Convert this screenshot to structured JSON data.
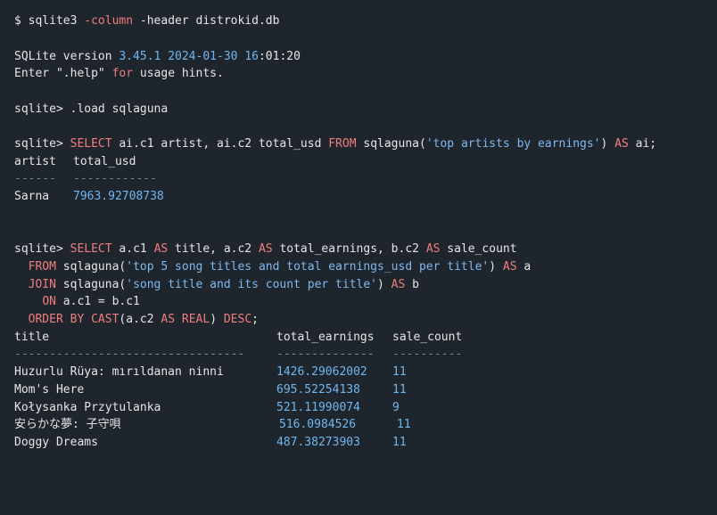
{
  "command": {
    "prompt": "$ ",
    "program": "sqlite3 ",
    "flag": "-column",
    "rest": " -header distrokid.db"
  },
  "banner": {
    "v_prefix": "SQLite version ",
    "version": "3.45.1",
    "sp": " ",
    "date": "2024-01-30",
    "sp2": " ",
    "hour": "16",
    "colon": ":01:20",
    "help_a": "Enter \".help\" ",
    "help_for": "for",
    "help_b": " usage hints."
  },
  "load": {
    "prompt": "sqlite> ",
    "text": ".load sqlaguna"
  },
  "query1": {
    "prompt": "sqlite> ",
    "select": "SELECT",
    "p1": " ai.c1 artist, ai.c2 total_usd ",
    "from": "FROM",
    "p2": " sqlaguna(",
    "str": "'top artists by earnings'",
    "p3": ") ",
    "as": "AS",
    "p4": " ai;",
    "headers": [
      "artist",
      "total_usd"
    ],
    "separators": [
      "------",
      "------------"
    ],
    "row": {
      "artist": "Sarna",
      "total_usd": "7963.92708738"
    }
  },
  "query2": {
    "l1": {
      "prompt": "sqlite> ",
      "select": "SELECT",
      "a": " a.c1 ",
      "as1": "AS",
      "b": " title, a.c2 ",
      "as2": "AS",
      "c": " total_earnings, b.c2 ",
      "as3": "AS",
      "d": " sale_count"
    },
    "l2": {
      "indent": "  ",
      "from": "FROM",
      "a": " sqlaguna(",
      "str": "'top 5 song titles and total earnings_usd per title'",
      "b": ") ",
      "as": "AS",
      "c": " a"
    },
    "l3": {
      "indent": "  ",
      "join": "JOIN",
      "a": " sqlaguna(",
      "str": "'song title and its count per title'",
      "b": ") ",
      "as": "AS",
      "c": " b"
    },
    "l4": {
      "indent": "    ",
      "on": "ON",
      "a": " a.c1 = b.c1"
    },
    "l5": {
      "indent": "  ",
      "order": "ORDER BY",
      "a": " ",
      "cast": "CAST",
      "b": "(a.c2 ",
      "as": "AS",
      "c": " ",
      "real": "REAL",
      "d": ") ",
      "desc": "DESC",
      "e": ";"
    },
    "headers": [
      "title",
      "total_earnings",
      "sale_count"
    ],
    "separators": [
      "---------------------------------",
      "--------------",
      "----------"
    ],
    "rows": [
      {
        "title": "Huzurlu Rüya: mırıldanan ninni",
        "total": "1426.29062002",
        "count": "11"
      },
      {
        "title": "Mom's Here",
        "total": "695.52254138",
        "count": "11"
      },
      {
        "title": "Kołysanka Przytulanka",
        "total": "521.11990074",
        "count": "9"
      },
      {
        "title": "安らかな夢: 子守唄",
        "total": "516.0984526",
        "count": "11"
      },
      {
        "title": "Doggy Dreams",
        "total": "487.38273903",
        "count": "11"
      }
    ]
  }
}
